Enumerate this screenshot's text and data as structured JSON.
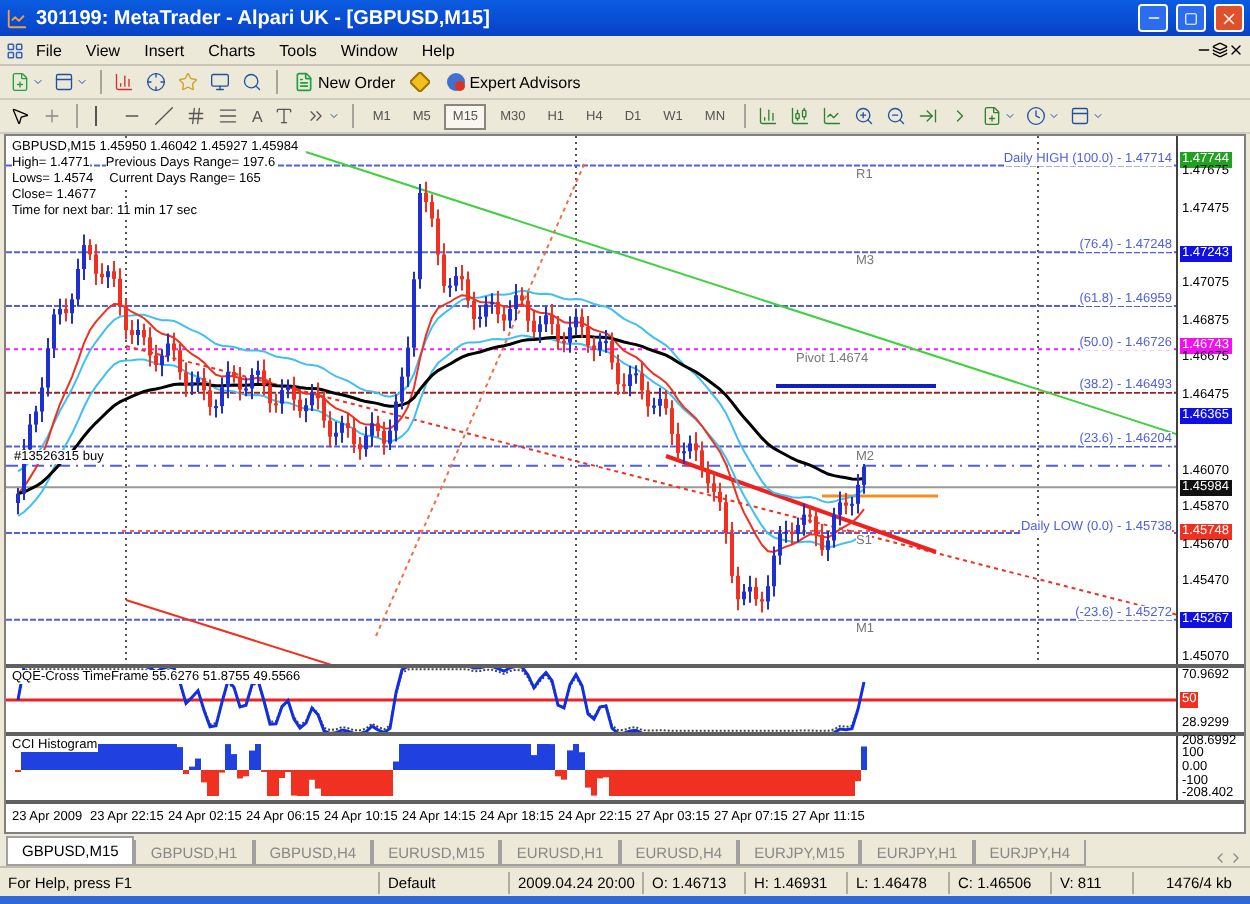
{
  "window": {
    "title": "301199: MetaTrader - Alpari UK - [GBPUSD,M15]"
  },
  "menu": [
    "File",
    "View",
    "Insert",
    "Charts",
    "Tools",
    "Window",
    "Help"
  ],
  "toolbar": {
    "buttons": [
      "New Order",
      "Expert Advisors"
    ],
    "text_tool": "A"
  },
  "timeframes": [
    {
      "label": "M1",
      "selected": false
    },
    {
      "label": "M5",
      "selected": false
    },
    {
      "label": "M15",
      "selected": true
    },
    {
      "label": "M30",
      "selected": false
    },
    {
      "label": "H1",
      "selected": false
    },
    {
      "label": "H4",
      "selected": false
    },
    {
      "label": "D1",
      "selected": false
    },
    {
      "label": "W1",
      "selected": false
    },
    {
      "label": "MN",
      "selected": false
    }
  ],
  "chart": {
    "info": [
      [
        "GBPUSD,M15  1.45950 1.46042 1.45927 1.45984"
      ],
      [
        "High= 1.4771",
        "Previous Days Range= 197.6"
      ],
      [
        "Lows= 1.4574",
        "Current Days Range= 165"
      ],
      [
        "Close= 1.4677"
      ],
      [
        "Time for next bar: 11 min 17 sec"
      ]
    ],
    "order_label": "#13526315 buy",
    "pivot_labels": [
      "R1",
      "M3",
      "Pivot  1.4674",
      "M2",
      "S1",
      "M1"
    ],
    "fib_labels": [
      "Daily HIGH (100.0) - 1.47714",
      "(76.4) - 1.47248",
      "(61.8) - 1.46959",
      "(50.0) - 1.46726",
      "(38.2) - 1.46493",
      "(23.6) - 1.46204",
      "Daily LOW (0.0) - 1.45738",
      "(-23.6) - 1.45272"
    ],
    "price_axis": [
      {
        "text": "1.47744",
        "kind": "highlight",
        "color": "#22a022"
      },
      {
        "text": "1.47675",
        "kind": "tick"
      },
      {
        "text": "1.47475",
        "kind": "tick"
      },
      {
        "text": "1.47243",
        "kind": "highlight",
        "color": "#1010e0"
      },
      {
        "text": "1.47075",
        "kind": "tick"
      },
      {
        "text": "1.46875",
        "kind": "tick"
      },
      {
        "text": "1.46743",
        "kind": "highlight",
        "color": "#f010f0"
      },
      {
        "text": "1.46675",
        "kind": "tick"
      },
      {
        "text": "1.46475",
        "kind": "tick"
      },
      {
        "text": "1.46365",
        "kind": "highlight",
        "color": "#1010e0"
      },
      {
        "text": "1.46070",
        "kind": "tick"
      },
      {
        "text": "1.45984",
        "kind": "highlight",
        "color": "#101010"
      },
      {
        "text": "1.45870",
        "kind": "tick"
      },
      {
        "text": "1.45748",
        "kind": "highlight",
        "color": "#f03020"
      },
      {
        "text": "1.45670",
        "kind": "tick"
      },
      {
        "text": "1.45470",
        "kind": "tick"
      },
      {
        "text": "1.45267",
        "kind": "highlight",
        "color": "#1010e0"
      },
      {
        "text": "1.45070",
        "kind": "tick"
      }
    ]
  },
  "qqe": {
    "label": "QQE-Cross TimeFrame 55.6276 51.8755 49.5566",
    "axis": [
      "70.9692",
      "50",
      "28.9299"
    ]
  },
  "cci": {
    "label": "CCI Histogram",
    "axis": [
      "208.6992",
      "100",
      "0.00",
      "-100",
      "-208.402"
    ]
  },
  "time_axis": [
    "23 Apr 2009",
    "23 Apr 22:15",
    "24 Apr 02:15",
    "24 Apr 06:15",
    "24 Apr 10:15",
    "24 Apr 14:15",
    "24 Apr 18:15",
    "24 Apr 22:15",
    "27 Apr 03:15",
    "27 Apr 07:15",
    "27 Apr 11:15"
  ],
  "tabs": [
    {
      "label": "GBPUSD,M15",
      "selected": true
    },
    {
      "label": "GBPUSD,H1",
      "selected": false
    },
    {
      "label": "GBPUSD,H4",
      "selected": false
    },
    {
      "label": "EURUSD,M15",
      "selected": false
    },
    {
      "label": "EURUSD,H1",
      "selected": false
    },
    {
      "label": "EURUSD,H4",
      "selected": false
    },
    {
      "label": "EURJPY,M15",
      "selected": false
    },
    {
      "label": "EURJPY,H1",
      "selected": false
    },
    {
      "label": "EURJPY,H4",
      "selected": false
    }
  ],
  "status_bar": {
    "help": "For Help, press F1",
    "profile": "Default",
    "time": "2009.04.24 20:00",
    "open": "O: 1.46713",
    "high": "H: 1.46931",
    "low": "L: 1.46478",
    "close": "C: 1.46506",
    "volume": "V: 811",
    "traffic": "1476/4 kb"
  }
}
